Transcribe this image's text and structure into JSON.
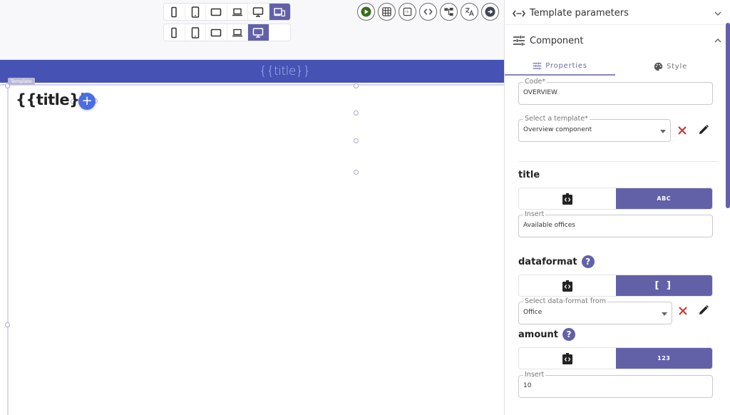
{
  "toolbar": {
    "device_rows": [
      [
        {
          "icon": "mobile-portrait-icon",
          "active": false
        },
        {
          "icon": "tablet-portrait-icon",
          "active": false
        },
        {
          "icon": "tablet-landscape-icon",
          "active": false
        },
        {
          "icon": "laptop-icon",
          "active": false
        },
        {
          "icon": "desktop-icon",
          "active": false
        },
        {
          "icon": "responsive-devices-icon",
          "active": true
        }
      ],
      [
        {
          "icon": "mobile-portrait-icon",
          "active": false
        },
        {
          "icon": "tablet-portrait-icon",
          "active": false
        },
        {
          "icon": "tablet-landscape-icon",
          "active": false
        },
        {
          "icon": "laptop-icon",
          "active": false
        },
        {
          "icon": "desktop-icon",
          "active": true
        }
      ]
    ],
    "tools": [
      "play-icon",
      "grid-icon",
      "layout-icon",
      "code-icon",
      "tree-icon",
      "translate-icon",
      "arrow-right-icon"
    ],
    "accent": "#6261a8"
  },
  "canvas": {
    "banner_text": "{{title}}",
    "banner_color": "#4652b4",
    "template_tag": "Template",
    "template_title": "{{title}}",
    "add_label": "+"
  },
  "panel": {
    "template_parameters_label": "Template parameters",
    "component_label": "Component",
    "tabs": [
      {
        "label": "Properties",
        "active": true
      },
      {
        "label": "Style",
        "active": false
      }
    ],
    "code": {
      "label": "Code*",
      "value": "OVERVIEW"
    },
    "template_select": {
      "label": "Select a template*",
      "value": "Overview component"
    },
    "title_section": {
      "label": "title",
      "mode_label": "ABC",
      "insert": {
        "label": "Insert",
        "value": "Available offices"
      }
    },
    "dataformat_section": {
      "label": "dataformat",
      "help": "?",
      "mode_label": "[ ]",
      "select": {
        "label": "Select data-format from",
        "value": "Office"
      }
    },
    "amount_section": {
      "label": "amount",
      "help": "?",
      "mode_label": "123",
      "insert": {
        "label": "Insert",
        "value": "10"
      }
    }
  }
}
